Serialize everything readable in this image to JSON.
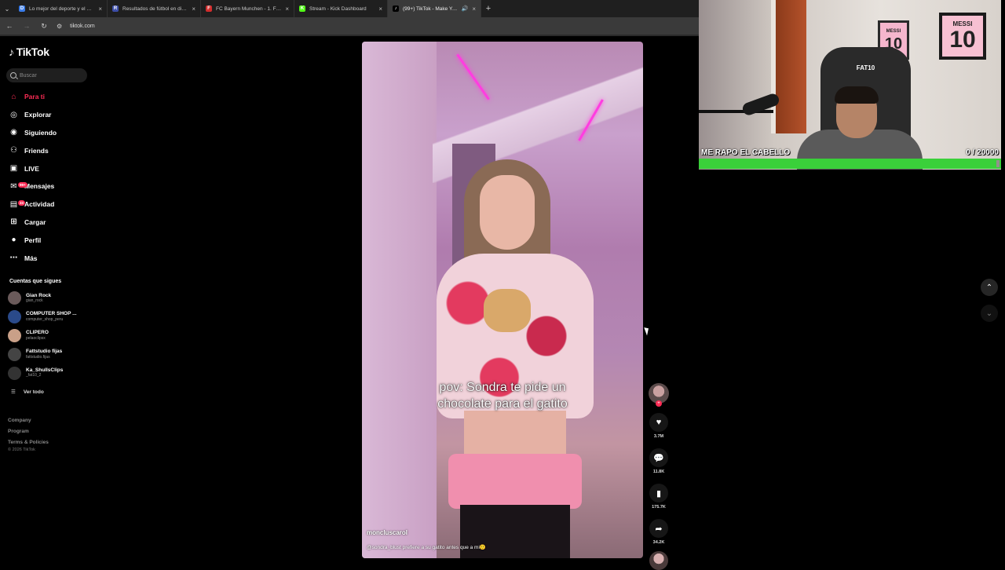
{
  "browser": {
    "tabs": [
      {
        "label": "Lo mejor del deporte y el entre",
        "favicon": "D",
        "color": "#3b7de9",
        "active": false
      },
      {
        "label": "Resultados de fútbol en directo",
        "favicon": "R",
        "color": "#3d4ea8",
        "active": false
      },
      {
        "label": "FC Bayern Munchen - 1. FC Uni",
        "favicon": "F",
        "color": "#d22d2d",
        "active": false
      },
      {
        "label": "Stream - Kick Dashboard",
        "favicon": "K",
        "color": "#53fc18",
        "active": false
      },
      {
        "label": "(99+) TikTok - Make Your D",
        "favicon": "♪",
        "color": "#000000",
        "active": true
      }
    ],
    "url": "tiktok.com"
  },
  "sidebar": {
    "logo": "TikTok",
    "search_placeholder": "Buscar",
    "menu": [
      {
        "label": "Para ti",
        "icon": "home-icon",
        "active": true,
        "badge": ""
      },
      {
        "label": "Explorar",
        "icon": "compass-icon",
        "active": false,
        "badge": ""
      },
      {
        "label": "Siguiendo",
        "icon": "following-icon",
        "active": false,
        "badge": ""
      },
      {
        "label": "Friends",
        "icon": "friends-icon",
        "active": false,
        "badge": ""
      },
      {
        "label": "LIVE",
        "icon": "live-icon",
        "active": false,
        "badge": ""
      },
      {
        "label": "Mensajes",
        "icon": "messages-icon",
        "active": false,
        "badge": "99+"
      },
      {
        "label": "Actividad",
        "icon": "activity-icon",
        "active": false,
        "badge": "33"
      },
      {
        "label": "Cargar",
        "icon": "upload-icon",
        "active": false,
        "badge": ""
      },
      {
        "label": "Perfil",
        "icon": "profile-icon",
        "active": false,
        "badge": ""
      },
      {
        "label": "Más",
        "icon": "more-icon",
        "active": false,
        "badge": ""
      }
    ],
    "following_title": "Cuentas que sigues",
    "following": [
      {
        "name": "Gian Rock",
        "handle": "gian_rock",
        "color": "#6a5a5a"
      },
      {
        "name": "COMPUTER SHOP ...",
        "handle": "computer_shop_peru",
        "color": "#2a4a8a"
      },
      {
        "name": "CLIPERO",
        "handle": "pelaoclipsx",
        "color": "#c9a088"
      },
      {
        "name": "Fattstudio fijas",
        "handle": "fattstudio.fijas",
        "color": "#444444"
      },
      {
        "name": "Ka_ShullsClips",
        "handle": "_fat10_2",
        "color": "#333333"
      }
    ],
    "see_all": "Ver todo",
    "footer_links": [
      "Company",
      "Program",
      "Terms & Policies"
    ],
    "copyright": "© 2026 TikTok"
  },
  "video": {
    "caption_line1": "pov: Sondra te pide un",
    "caption_line2": "chocolate para el gatito",
    "author": "moncluscarol",
    "description": "@sondra_blust prefiere a su gatito antes que a mi🙂"
  },
  "actions": {
    "likes": "3.7M",
    "comments": "11.8K",
    "saves": "175.7K",
    "shares": "34.2K"
  },
  "webcam": {
    "chair_label": "FAT10",
    "jersey_text_1": "MESSI",
    "jersey_num_1": "10",
    "jersey_text_2": "MESSI",
    "jersey_num_2": "10",
    "goal_text": "ME RAPO EL CABELLO",
    "goal_current": "0",
    "goal_total": "/ 20000",
    "goal_progress": 0.99,
    "bar_color": "#3ad03a"
  }
}
